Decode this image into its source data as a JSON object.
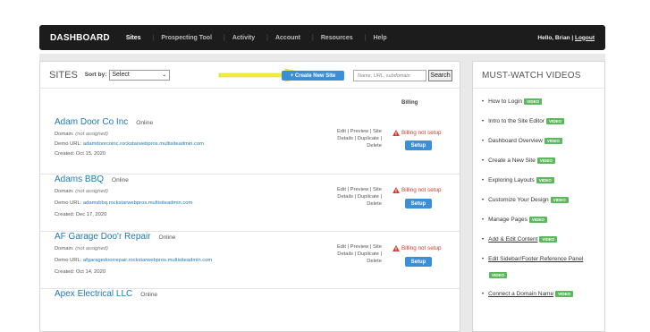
{
  "nav": {
    "brand": "DASHBOARD",
    "items": [
      "Sites",
      "Prospecting Tool",
      "Activity",
      "Account",
      "Resources",
      "Help"
    ],
    "user_greeting": "Hello, Brian |",
    "logout": "Logout"
  },
  "sites": {
    "title": "SITES",
    "sort_label": "Sort by:",
    "sort_value": "Select",
    "create_button": "+ Create New Site",
    "search_placeholder": "Name, URL, subdomain",
    "search_button": "Search",
    "billing_header": "Billing",
    "rows": [
      {
        "name": "Adam Door Co Inc",
        "status": "Online",
        "domain_label": "Domain:",
        "domain_value": "(not assigned)",
        "demo_label": "Demo URL:",
        "demo_url": "adamdoorcoinc.rockstarwebpros.multisiteadmin.com",
        "created": "Created: Oct 15, 2020",
        "actions": "Edit | Preview | Site Details | Duplicate | Delete",
        "billing": "Billing not setup",
        "setup": "Setup"
      },
      {
        "name": "Adams BBQ",
        "status": "Online",
        "domain_label": "Domain:",
        "domain_value": "(not assigned)",
        "demo_label": "Demo URL:",
        "demo_url": "adamsbbq.rockstarwebpros.multisiteadmin.com",
        "created": "Created: Dec 17, 2020",
        "actions": "Edit | Preview | Site Details | Duplicate | Delete",
        "billing": "Billing not setup",
        "setup": "Setup"
      },
      {
        "name": "AF Garage Doo'r Repair",
        "status": "Online",
        "domain_label": "Domain:",
        "domain_value": "(not assigned)",
        "demo_label": "Demo URL:",
        "demo_url": "afgaragedoorrepair.rockstarwebpros.multisiteadmin.com",
        "created": "Created: Oct 14, 2020",
        "actions": "Edit | Preview | Site Details | Duplicate | Delete",
        "billing": "Billing not setup",
        "setup": "Setup"
      },
      {
        "name": "Apex Electrical LLC",
        "status": "Online"
      }
    ]
  },
  "videos": {
    "title": "MUST-WATCH VIDEOS",
    "badge": "VIDEO",
    "items": [
      "How to Login",
      "Intro to the Site Editor",
      "Dashboard Overview",
      "Create a New Site",
      "Exploring Layouts",
      "Customize Your Design",
      "Manage Pages",
      "Add & Edit Content",
      "Edit Sidebar/Footer Reference Panel",
      "Connect a Domain Name"
    ]
  },
  "colors": {
    "nav_bg": "#1c1c1c",
    "accent": "#3a8fd6",
    "link": "#1f78b4",
    "warning": "#d43b2b",
    "badge": "#5cb85c",
    "arrow": "#f1ee3a"
  }
}
